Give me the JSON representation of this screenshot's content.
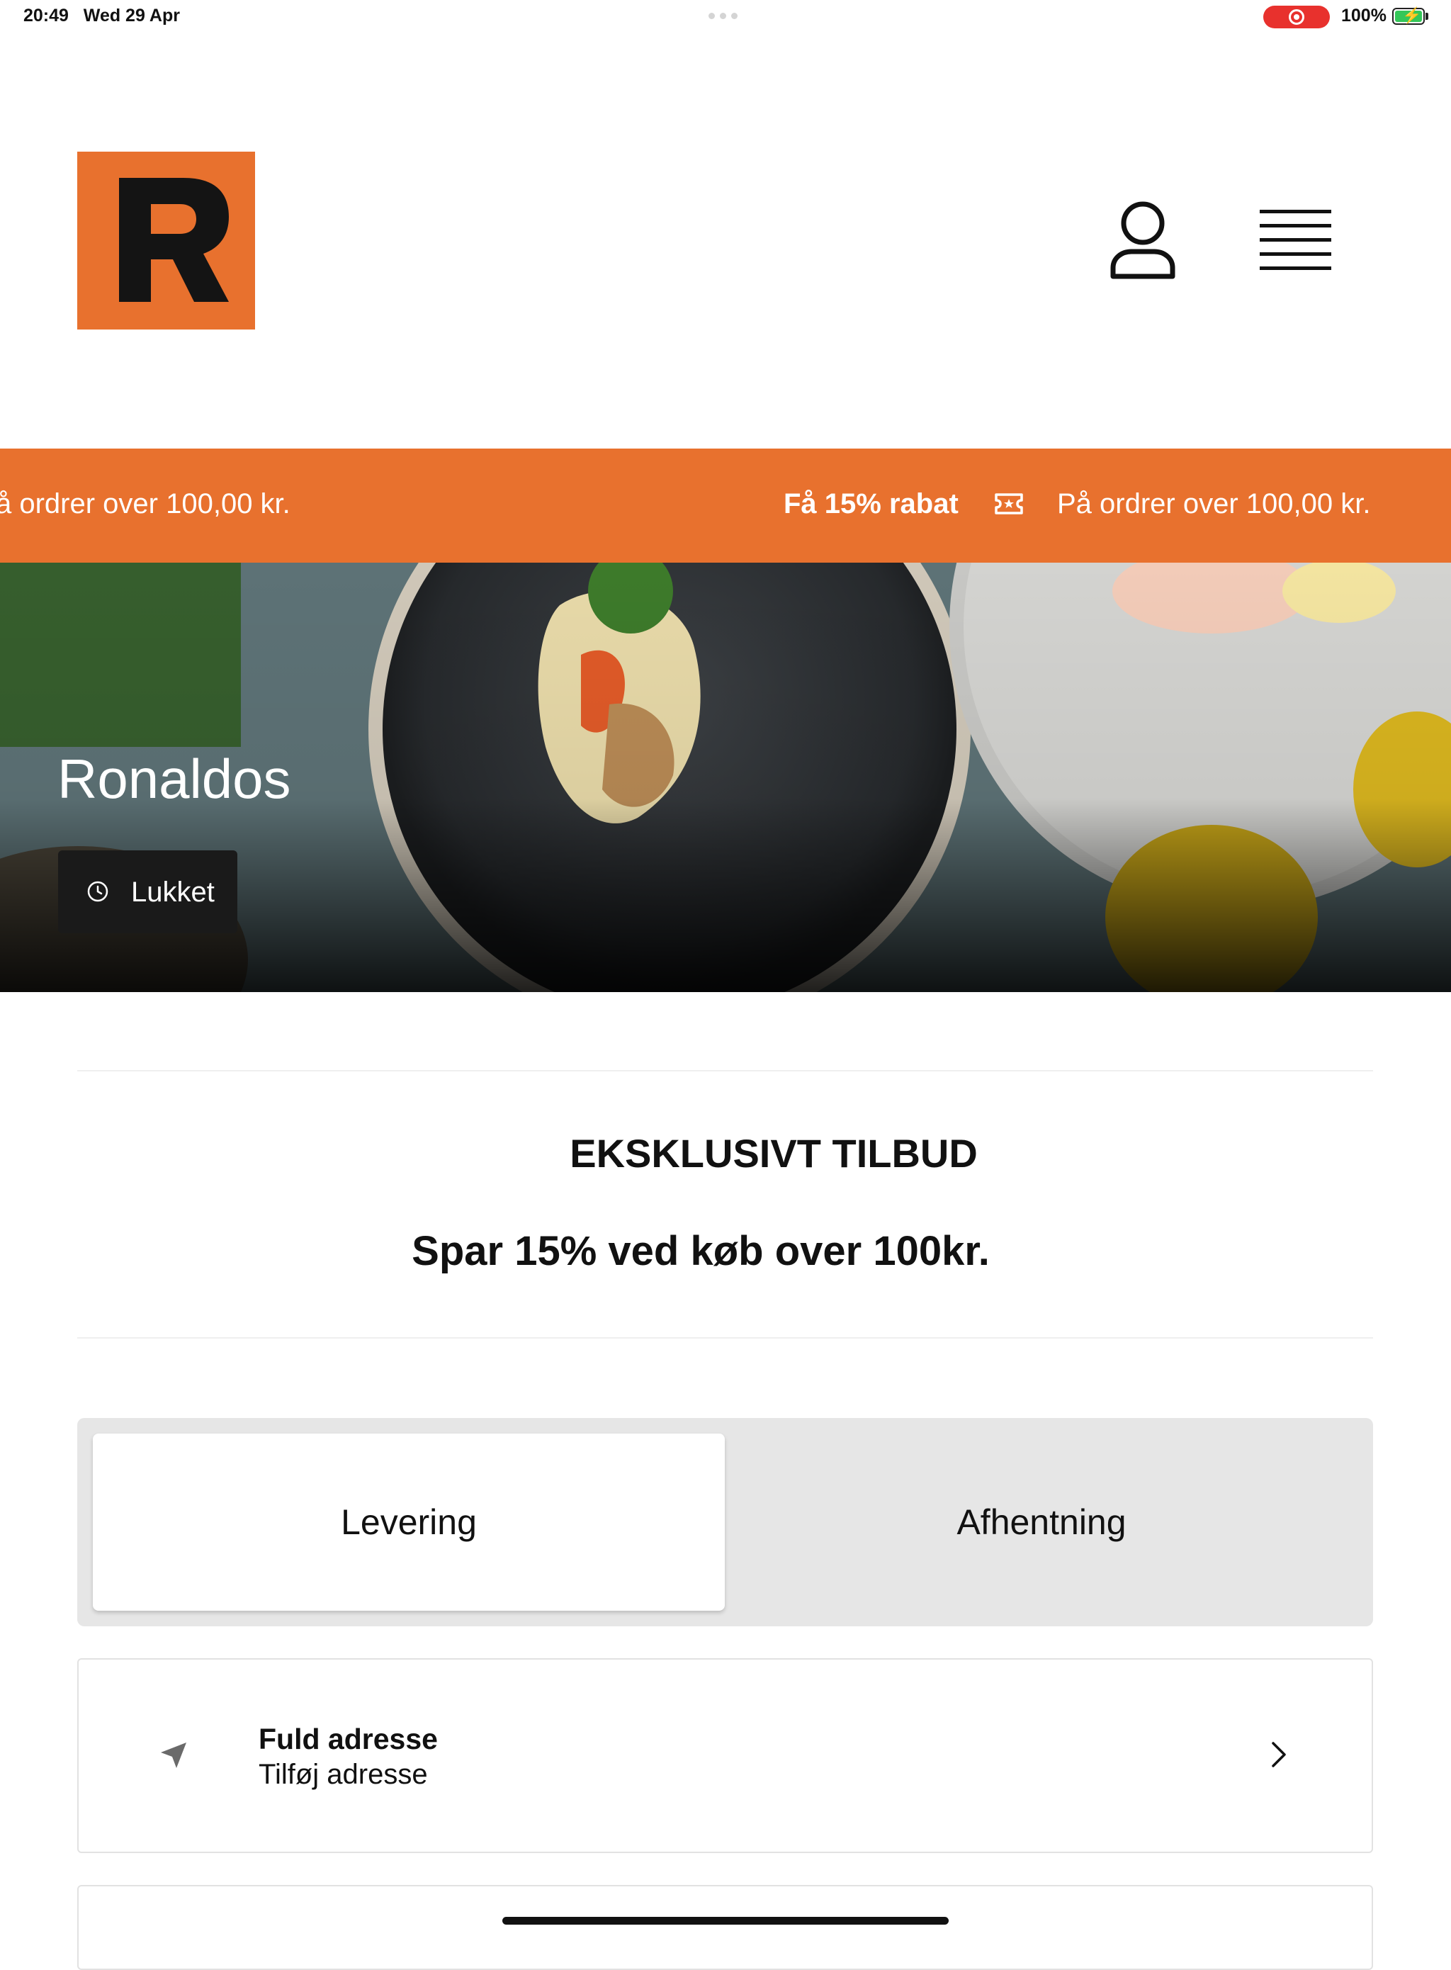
{
  "status_bar": {
    "time": "20:49",
    "date": "Wed 29 Apr",
    "battery": "100%"
  },
  "brand": {
    "logo_letter": "R",
    "accent_color": "#e8712e"
  },
  "header": {
    "account_icon": "user-icon",
    "menu_icon": "hamburger-menu-icon"
  },
  "promo_banner": {
    "left_fragment": "å ordrer over 100,00 kr.",
    "highlight": "Få 15% rabat",
    "icon": "ticket-icon",
    "detail": "På ordrer over 100,00 kr."
  },
  "hero": {
    "restaurant_name": "Ronaldos",
    "status_label": "Lukket",
    "status_icon": "clock-icon"
  },
  "offer": {
    "title": "EKSKLUSIVT TILBUD",
    "subtitle": "Spar 15% ved køb over 100kr."
  },
  "order_type": {
    "tabs": [
      {
        "label": "Levering",
        "selected": true
      },
      {
        "label": "Afhentning",
        "selected": false
      }
    ]
  },
  "address": {
    "title": "Fuld adresse",
    "value": "Tilføj adresse"
  }
}
